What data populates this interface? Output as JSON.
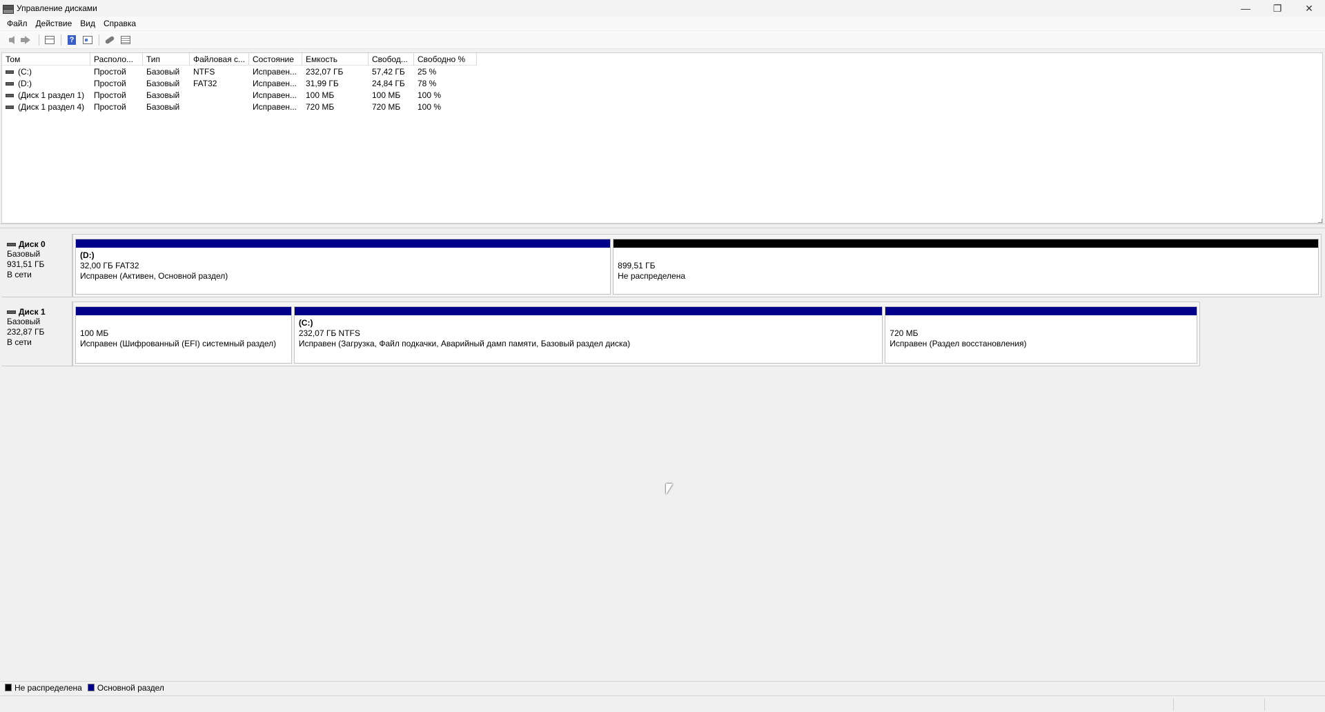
{
  "window": {
    "title": "Управление дисками",
    "controls": {
      "minimize": "—",
      "restore": "❐",
      "close": "✕"
    }
  },
  "menu": [
    "Файл",
    "Действие",
    "Вид",
    "Справка"
  ],
  "toolbar": {
    "icons": [
      "back-icon",
      "forward-icon",
      "console-tree-icon",
      "help-icon",
      "properties-icon",
      "connect-icon",
      "list-view-icon"
    ],
    "help_glyph": "?"
  },
  "volume_list": {
    "columns": [
      "Том",
      "Располо...",
      "Тип",
      "Файловая с...",
      "Состояние",
      "Емкость",
      "Свобод...",
      "Свободно %"
    ],
    "rows": [
      [
        "(C:)",
        "Простой",
        "Базовый",
        "NTFS",
        "Исправен...",
        "232,07 ГБ",
        "57,42 ГБ",
        "25 %"
      ],
      [
        "(D:)",
        "Простой",
        "Базовый",
        "FAT32",
        "Исправен...",
        "31,99 ГБ",
        "24,84 ГБ",
        "78 %"
      ],
      [
        "(Диск 1 раздел 1)",
        "Простой",
        "Базовый",
        "",
        "Исправен...",
        "100 МБ",
        "100 МБ",
        "100 %"
      ],
      [
        "(Диск 1 раздел 4)",
        "Простой",
        "Базовый",
        "",
        "Исправен...",
        "720 МБ",
        "720 МБ",
        "100 %"
      ]
    ]
  },
  "disks": [
    {
      "name": "Диск 0",
      "type": "Базовый",
      "size": "931,51 ГБ",
      "status": "В сети",
      "partitions": [
        {
          "name": "(D:)",
          "line1": "32,00 ГБ FAT32",
          "line2": "Исправен (Активен, Основной раздел)",
          "kind": "primary"
        },
        {
          "name": "",
          "line1": "899,51 ГБ",
          "line2": "Не распределена",
          "kind": "unallocated"
        }
      ]
    },
    {
      "name": "Диск 1",
      "type": "Базовый",
      "size": "232,87 ГБ",
      "status": "В сети",
      "partitions": [
        {
          "name": "",
          "line1": "100 МБ",
          "line2": "Исправен (Шифрованный (EFI) системный раздел)",
          "kind": "primary"
        },
        {
          "name": "(C:)",
          "line1": "232,07 ГБ NTFS",
          "line2": "Исправен (Загрузка, Файл подкачки, Аварийный дамп памяти, Базовый раздел диска)",
          "kind": "primary"
        },
        {
          "name": "",
          "line1": "720 МБ",
          "line2": "Исправен (Раздел восстановления)",
          "kind": "primary"
        }
      ]
    }
  ],
  "legend": [
    {
      "label": "Не распределена",
      "color": "#000000"
    },
    {
      "label": "Основной раздел",
      "color": "#00008b"
    }
  ],
  "colors": {
    "primary": "#00008b",
    "unallocated": "#000000"
  }
}
